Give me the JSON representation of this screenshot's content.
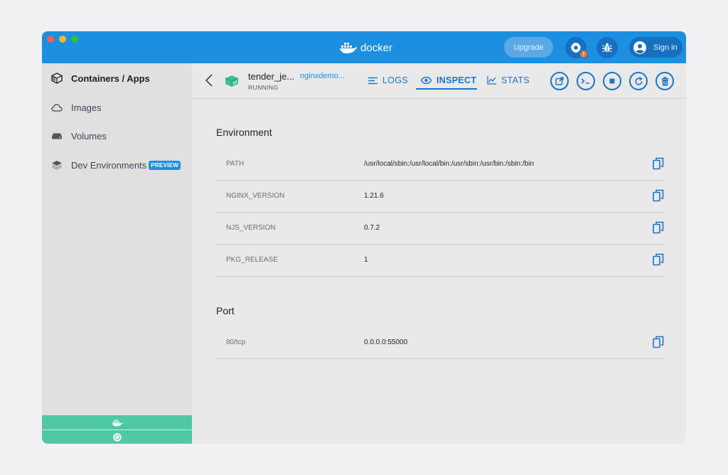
{
  "app": {
    "brand": "docker",
    "accent_color": "#1d8fe0",
    "upgrade_label": "Upgrade",
    "signin_label": "Sign in",
    "settings_warning": "!"
  },
  "sidebar": {
    "items": [
      {
        "label": "Containers / Apps",
        "icon": "containers-icon",
        "active": true
      },
      {
        "label": "Images",
        "icon": "cloud-icon"
      },
      {
        "label": "Volumes",
        "icon": "volume-icon"
      },
      {
        "label": "Dev Environments",
        "icon": "layers-icon",
        "badge": "PREVIEW"
      }
    ]
  },
  "container": {
    "name": "tender_je...",
    "status": "RUNNING",
    "image": "nginxdemo..."
  },
  "tabs": [
    {
      "label": "LOGS",
      "icon": "logs-icon"
    },
    {
      "label": "INSPECT",
      "icon": "eye-icon",
      "active": true
    },
    {
      "label": "STATS",
      "icon": "chart-icon"
    }
  ],
  "actions": [
    "open-in-browser",
    "cli",
    "stop",
    "restart",
    "delete"
  ],
  "environment": {
    "title": "Environment",
    "rows": [
      {
        "key": "PATH",
        "value": "/usr/local/sbin:/usr/local/bin:/usr/sbin:/usr/bin:/sbin:/bin"
      },
      {
        "key": "NGINX_VERSION",
        "value": "1.21.6"
      },
      {
        "key": "NJS_VERSION",
        "value": "0.7.2"
      },
      {
        "key": "PKG_RELEASE",
        "value": "1"
      }
    ]
  },
  "port": {
    "title": "Port",
    "rows": [
      {
        "key": "80/tcp",
        "value": "0.0.0.0:55000"
      }
    ]
  }
}
